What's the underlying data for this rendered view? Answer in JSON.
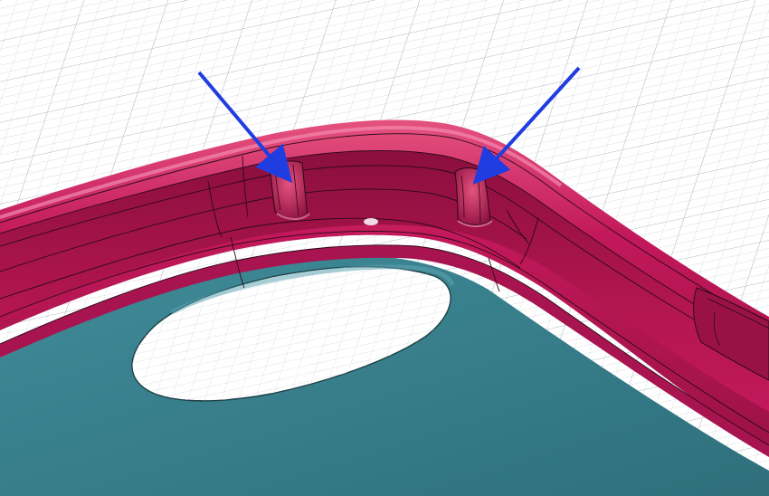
{
  "viewport": {
    "background": "#ffffff",
    "grid_color": "#c8cdd3",
    "grid_major_color": "#b4bac2"
  },
  "model": {
    "case_body_color": "#c2185b",
    "case_highlight_color": "#e5527f",
    "case_shadow_color": "#8a0f3e",
    "edge_line_color": "#2a0a16",
    "back_plate_color": "#3a8290",
    "back_plate_dark_color": "#2f6f7c",
    "camera_cutout_color": "#ffffff"
  },
  "annotations": {
    "arrow_color": "#1f3de0",
    "arrows": [
      {
        "name": "arrow-left-notch",
        "target": "left-button-notch"
      },
      {
        "name": "arrow-right-notch",
        "target": "right-button-notch"
      }
    ]
  }
}
